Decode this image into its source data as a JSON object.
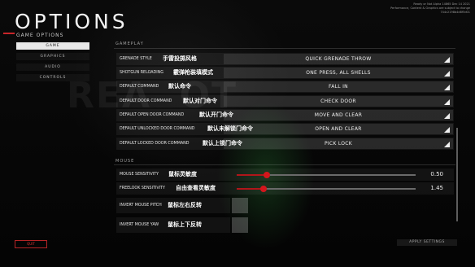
{
  "header": {
    "title": "OPTIONS",
    "subtitle": "GAME OPTIONS",
    "version_lines": [
      "Ready or Not Alpha 14865 Dec 14 2021",
      "Performance, Content & Graphics are subject to change",
      "744c2198b4d8f5d01"
    ]
  },
  "tabs": [
    {
      "label": "GAME",
      "active": true
    },
    {
      "label": "GRAPHICS",
      "active": false
    },
    {
      "label": "AUDIO",
      "active": false
    },
    {
      "label": "CONTROLS",
      "active": false
    }
  ],
  "gameplay": {
    "section_title": "GAMEPLAY",
    "rows": [
      {
        "label": "GRENADE STYLE",
        "cn": "手雷投掷风格",
        "value": "QUICK GRENADE THROW"
      },
      {
        "label": "SHOTGUN RELOADING",
        "cn": "霰弹枪装填模式",
        "value": "ONE PRESS, ALL SHELLS"
      },
      {
        "label": "DEFAULT COMMAND",
        "cn": "默认命令",
        "value": "FALL IN"
      },
      {
        "label": "DEFAULT DOOR COMMAND",
        "cn": "默认对门命令",
        "value": "CHECK DOOR"
      },
      {
        "label": "DEFAULT OPEN DOOR COMMAND",
        "cn": "默认开门命令",
        "value": "MOVE AND CLEAR"
      },
      {
        "label": "DEFAULT UNLOCKED DOOR COMMAND",
        "cn": "默认未解锁门命令",
        "value": "OPEN AND CLEAR"
      },
      {
        "label": "DEFAULT LOCKED DOOR COMMAND",
        "cn": "默认上锁门命令",
        "value": "PICK LOCK"
      }
    ]
  },
  "mouse": {
    "section_title": "MOUSE",
    "sliders": [
      {
        "label": "MOUSE SENSITIVITY",
        "cn": "鼠标灵敏度",
        "value": "0.50",
        "level": 0.17
      },
      {
        "label": "FREELOOK SENSITIVITY",
        "cn": "自由查看灵敏度",
        "value": "1.45",
        "level": 0.15
      }
    ],
    "toggles": [
      {
        "label": "INVERT MOUSE PITCH",
        "cn": "鼠标左右反转"
      },
      {
        "label": "INVERT MOUSE YAW",
        "cn": "鼠标上下反转"
      }
    ]
  },
  "footer": {
    "quit_label": "QUIT",
    "apply_label": "APPLY SETTINGS"
  },
  "colors": {
    "accent": "#c8262a",
    "slider_knob": "#d3161c"
  }
}
